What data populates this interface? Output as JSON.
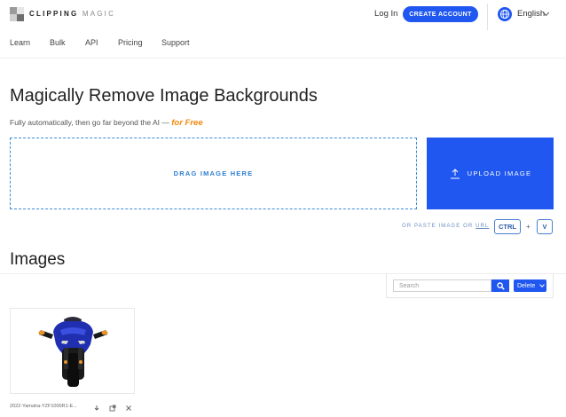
{
  "header": {
    "brand_bold": "CLIPPING",
    "brand_light": "MAGIC",
    "login": "Log In",
    "create_account": "CREATE ACCOUNT",
    "language": "English"
  },
  "nav": {
    "items": [
      "Learn",
      "Bulk",
      "API",
      "Pricing",
      "Support"
    ]
  },
  "hero": {
    "title": "Magically Remove Image Backgrounds",
    "subtitle": "Fully automatically, then go far beyond the AI —",
    "subtitle_highlight": "for Free"
  },
  "upload": {
    "drag_label": "DRAG IMAGE HERE",
    "upload_label": "UPLOAD IMAGE",
    "paste_text": "OR PASTE IMAGE OR",
    "paste_url": "URL",
    "key_ctrl": "CTRL",
    "key_plus": "+",
    "key_v": "V"
  },
  "images": {
    "heading": "Images",
    "search_placeholder": "Search",
    "delete_label": "Delete",
    "items": [
      {
        "filename": "2022-Yamaha-YZF1000R1-E..."
      }
    ]
  },
  "colors": {
    "accent": "#1f57f0",
    "highlight": "#f08a0c",
    "dashed_border": "#3a8bd8"
  },
  "icons": [
    "logo-icon",
    "globe-icon",
    "chevron-down-icon",
    "upload-icon",
    "search-icon",
    "download-icon",
    "open-external-icon",
    "close-icon"
  ]
}
